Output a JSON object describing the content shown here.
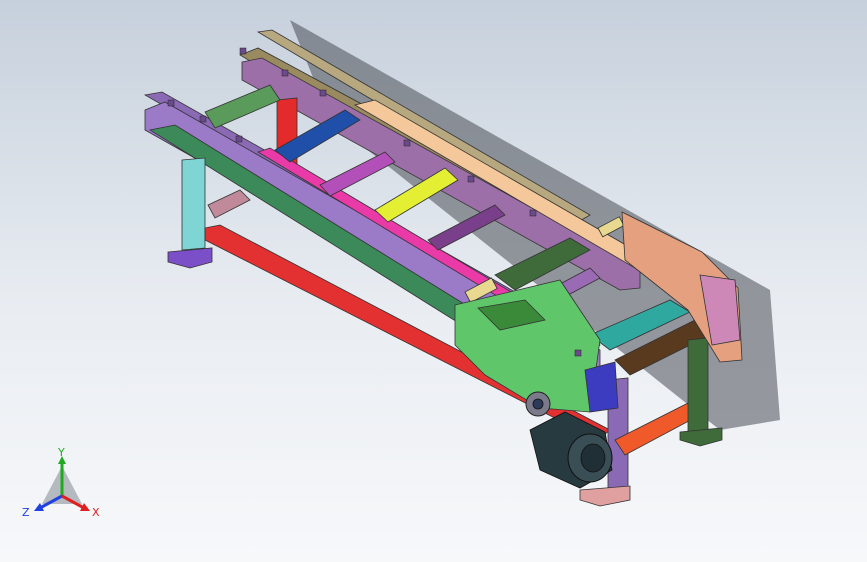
{
  "viewport": {
    "background_top": "#c6d0dc",
    "background_bottom": "#f7f8fa"
  },
  "triad": {
    "y_label": "Y",
    "z_label": "Z",
    "x_label": "X",
    "y_color": "#1faa1f",
    "z_color": "#2040e0",
    "x_color": "#e02020"
  }
}
